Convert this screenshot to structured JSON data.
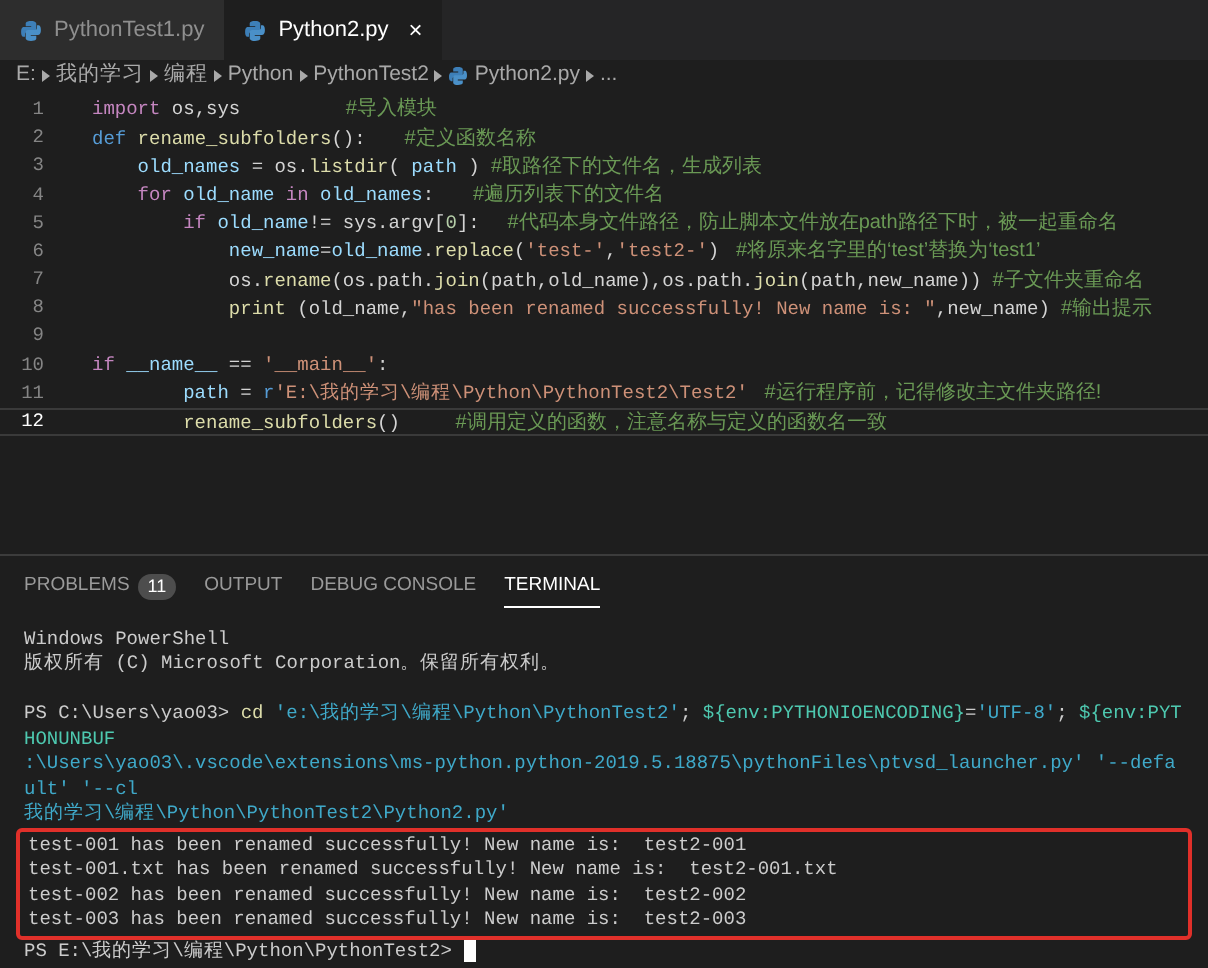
{
  "tabs": [
    {
      "label": "PythonTest1.py",
      "selected": false
    },
    {
      "label": "Python2.py",
      "selected": true,
      "close": "×"
    }
  ],
  "breadcrumb": [
    {
      "label": "E:",
      "kind": "folder"
    },
    {
      "label": "我的学习",
      "kind": "folder"
    },
    {
      "label": "编程",
      "kind": "folder"
    },
    {
      "label": "Python",
      "kind": "folder"
    },
    {
      "label": "PythonTest2",
      "kind": "folder"
    },
    {
      "label": "Python2.py",
      "kind": "file"
    },
    {
      "label": "...",
      "kind": "more"
    }
  ],
  "code": [
    {
      "number": "1",
      "current": false,
      "tokens": [
        {
          "t": "import",
          "kind": "keyword"
        },
        {
          "t": " os,sys",
          "kind": "plain"
        },
        {
          "t": "                   #导入模块",
          "kind": "comment"
        }
      ]
    },
    {
      "number": "2",
      "current": false,
      "tokens": [
        {
          "t": "def",
          "kind": "storage"
        },
        {
          "t": " rename_subfolders",
          "kind": "function"
        },
        {
          "t": "():",
          "kind": "plain"
        },
        {
          "t": "       #定义函数名称",
          "kind": "comment"
        }
      ]
    },
    {
      "number": "3",
      "current": false,
      "tokens": [
        {
          "t": "    old_names",
          "kind": "variable"
        },
        {
          "t": " = os.",
          "kind": "plain"
        },
        {
          "t": "listdir",
          "kind": "function"
        },
        {
          "t": "( ",
          "kind": "plain"
        },
        {
          "t": "path",
          "kind": "variable"
        },
        {
          "t": " )",
          "kind": "plain"
        },
        {
          "t": "  #取路径下的文件名，生成列表",
          "kind": "comment"
        }
      ]
    },
    {
      "number": "4",
      "current": false,
      "tokens": [
        {
          "t": "    for",
          "kind": "keyword"
        },
        {
          "t": " old_name",
          "kind": "variable"
        },
        {
          "t": " in",
          "kind": "keyword"
        },
        {
          "t": " old_names",
          "kind": "variable"
        },
        {
          "t": ":",
          "kind": "plain"
        },
        {
          "t": "       #遍历列表下的文件名",
          "kind": "comment"
        }
      ]
    },
    {
      "number": "5",
      "current": false,
      "tokens": [
        {
          "t": "        if",
          "kind": "keyword"
        },
        {
          "t": " old_name",
          "kind": "variable"
        },
        {
          "t": "!= sys.argv[",
          "kind": "plain"
        },
        {
          "t": "0",
          "kind": "number"
        },
        {
          "t": "]:",
          "kind": "plain"
        },
        {
          "t": "     #代码本身文件路径，防止脚本文件放在path路径下时，被一起重命名",
          "kind": "comment"
        }
      ]
    },
    {
      "number": "6",
      "current": false,
      "tokens": [
        {
          "t": "            new_name",
          "kind": "variable"
        },
        {
          "t": "=",
          "kind": "plain"
        },
        {
          "t": "old_name",
          "kind": "variable"
        },
        {
          "t": ".",
          "kind": "plain"
        },
        {
          "t": "replace",
          "kind": "function"
        },
        {
          "t": "(",
          "kind": "plain"
        },
        {
          "t": "'test-'",
          "kind": "string"
        },
        {
          "t": ",",
          "kind": "plain"
        },
        {
          "t": "'test2-'",
          "kind": "string"
        },
        {
          "t": ")",
          "kind": "plain"
        },
        {
          "t": "   #将原来名字里的‘test’替换为‘test1’",
          "kind": "comment"
        }
      ]
    },
    {
      "number": "7",
      "current": false,
      "tokens": [
        {
          "t": "            os.",
          "kind": "plain"
        },
        {
          "t": "rename",
          "kind": "function"
        },
        {
          "t": "(os.path.",
          "kind": "plain"
        },
        {
          "t": "join",
          "kind": "function"
        },
        {
          "t": "(path,old_name),os.path.",
          "kind": "plain"
        },
        {
          "t": "join",
          "kind": "function"
        },
        {
          "t": "(path,new_name))",
          "kind": "plain"
        },
        {
          "t": "  #子文件夹重命名",
          "kind": "comment"
        }
      ]
    },
    {
      "number": "8",
      "current": false,
      "tokens": [
        {
          "t": "            print",
          "kind": "function"
        },
        {
          "t": " (old_name,",
          "kind": "plain"
        },
        {
          "t": "\"has been renamed successfully! New name is: \"",
          "kind": "string"
        },
        {
          "t": ",new_name)",
          "kind": "plain"
        },
        {
          "t": "  #输出提示",
          "kind": "comment"
        }
      ]
    },
    {
      "number": "9",
      "current": false
    },
    {
      "number": "10",
      "current": false,
      "tokens": [
        {
          "t": "if",
          "kind": "keyword"
        },
        {
          "t": " __name__",
          "kind": "variable"
        },
        {
          "t": " == ",
          "kind": "plain"
        },
        {
          "t": "'__main__'",
          "kind": "string"
        },
        {
          "t": ":",
          "kind": "plain"
        }
      ]
    },
    {
      "number": "11",
      "current": false,
      "tokens": [
        {
          "t": "        path",
          "kind": "variable"
        },
        {
          "t": " = ",
          "kind": "plain"
        },
        {
          "t": "r",
          "kind": "storage"
        },
        {
          "t": "'E:\\我的学习\\编程\\Python\\PythonTest2\\Test2'",
          "kind": "string"
        },
        {
          "t": "   #运行程序前，记得修改主文件夹路径!",
          "kind": "comment"
        }
      ]
    },
    {
      "number": "12",
      "current": true,
      "tokens": [
        {
          "t": "        rename_subfolders",
          "kind": "function"
        },
        {
          "t": "()",
          "kind": "plain"
        },
        {
          "t": "          #调用定义的函数，注意名称与定义的函数名一致",
          "kind": "comment"
        }
      ]
    }
  ],
  "panel_tabs": [
    {
      "label": "PROBLEMS",
      "badge": "11",
      "selected": false
    },
    {
      "label": "OUTPUT",
      "selected": false
    },
    {
      "label": "DEBUG CONSOLE",
      "selected": false
    },
    {
      "label": "TERMINAL",
      "selected": true
    }
  ],
  "terminal": {
    "banner": [
      "Windows PowerShell",
      "版权所有 (C) Microsoft Corporation。保留所有权利。"
    ],
    "command_lines": [
      [
        {
          "t": "PS C:\\Users\\yao03>",
          "kind": "plain"
        },
        {
          "t": " cd",
          "kind": "command"
        },
        {
          "t": " 'e:\\我的学习\\编程\\Python\\PythonTest2'",
          "kind": "string"
        },
        {
          "t": "; ",
          "kind": "plain"
        },
        {
          "t": "${env:PYTHONIOENCODING}",
          "kind": "variable"
        },
        {
          "t": "=",
          "kind": "plain"
        },
        {
          "t": "'UTF-8'",
          "kind": "string"
        },
        {
          "t": "; ",
          "kind": "plain"
        },
        {
          "t": "${env:PYTHONUNBUF",
          "kind": "variable"
        }
      ],
      [
        {
          "t": ":\\Users\\yao03\\.vscode\\extensions\\ms-python.python-2019.5.18875\\pythonFiles\\ptvsd_launcher.py' '--default' '--cl",
          "kind": "string"
        }
      ],
      [
        {
          "t": "我的学习\\编程\\Python\\PythonTest2\\Python2.py'",
          "kind": "string"
        }
      ]
    ],
    "highlighted_output": [
      "test-001 has been renamed successfully! New name is:  test2-001",
      "test-001.txt has been renamed successfully! New name is:  test2-001.txt",
      "test-002 has been renamed successfully! New name is:  test2-002",
      "test-003 has been renamed successfully! New name is:  test2-003"
    ],
    "prompt": "PS E:\\我的学习\\编程\\Python\\PythonTest2> "
  }
}
